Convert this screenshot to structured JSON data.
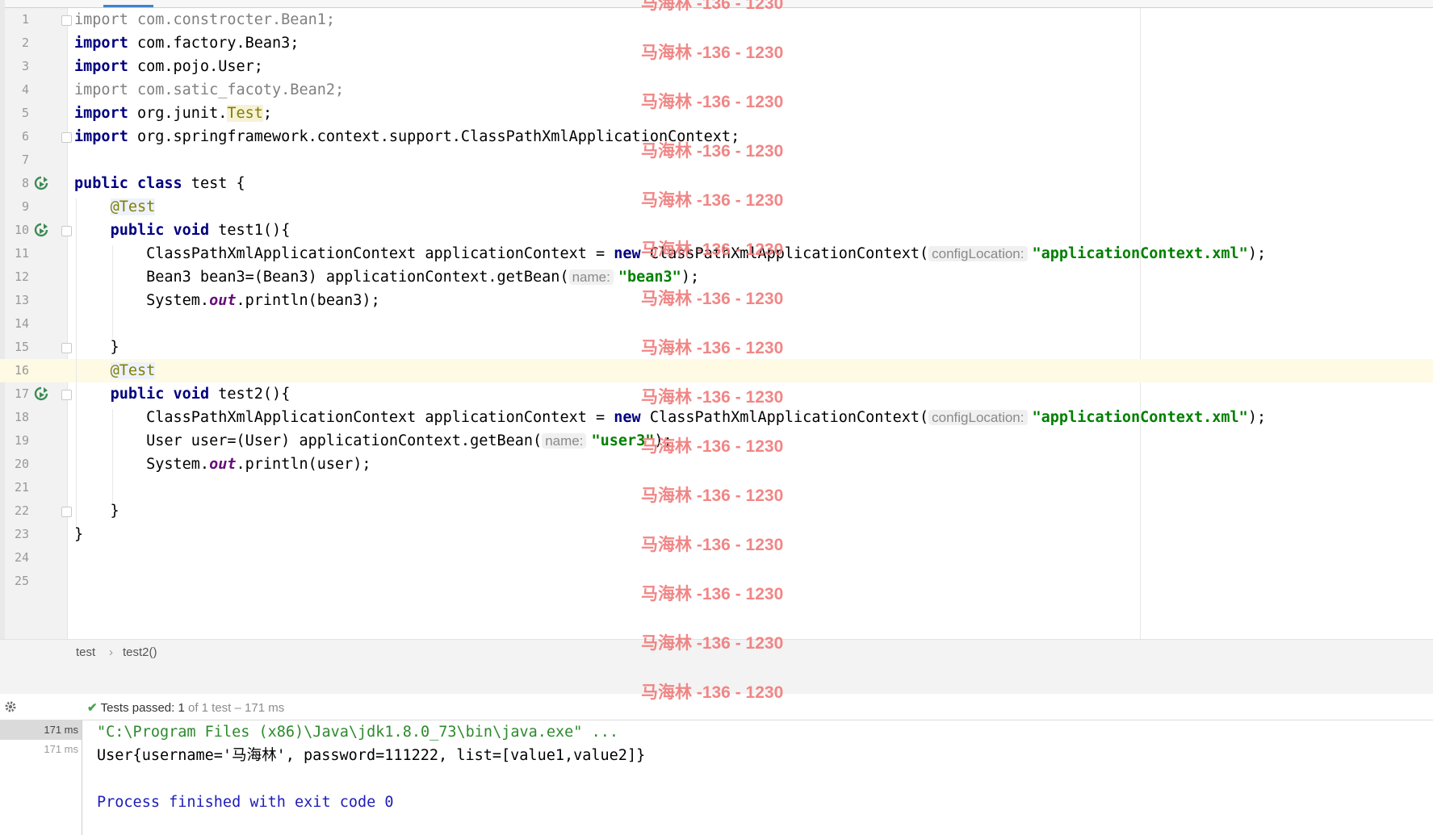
{
  "editor": {
    "lines": [
      {
        "n": "1"
      },
      {
        "n": "2"
      },
      {
        "n": "3"
      },
      {
        "n": "4"
      },
      {
        "n": "5"
      },
      {
        "n": "6"
      },
      {
        "n": "7"
      },
      {
        "n": "8"
      },
      {
        "n": "9"
      },
      {
        "n": "10"
      },
      {
        "n": "11"
      },
      {
        "n": "12"
      },
      {
        "n": "13"
      },
      {
        "n": "14"
      },
      {
        "n": "15"
      },
      {
        "n": "16"
      },
      {
        "n": "17"
      },
      {
        "n": "18"
      },
      {
        "n": "19"
      },
      {
        "n": "20"
      },
      {
        "n": "21"
      },
      {
        "n": "22"
      },
      {
        "n": "23"
      },
      {
        "n": "24"
      },
      {
        "n": "25"
      }
    ],
    "code": {
      "import_kw": "import",
      "l1_rest": " com.constrocter.Bean1;",
      "l2_rest": " com.factory.Bean3;",
      "l3_rest": " com.pojo.User;",
      "l4_rest": " com.satic_facoty.Bean2;",
      "l5_rest": " org.junit.",
      "l5_test": "Test",
      "l5_semi": ";",
      "l6_rest": " org.springframework.context.support.ClassPathXmlApplicationContext;",
      "l8_public": "public",
      "l8_class": "class",
      "l8_rest": " test {",
      "ann_test": "@Test",
      "l10_public": "public",
      "l10_void": "void",
      "l10_rest": " test1(){",
      "l11_pre": "        ClassPathXmlApplicationContext applicationContext = ",
      "new_kw": "new",
      "l11_mid": " ClassPathXmlApplicationContext(",
      "hint_config": "configLocation:",
      "str_appctx": "\"applicationContext.xml\"",
      "l11_end": ");",
      "l12_pre": "        Bean3 bean3=(Bean3) applicationContext.getBean(",
      "hint_name": "name:",
      "str_bean3": "\"bean3\"",
      "l12_end": ");",
      "l13_pre": "        System.",
      "out_field": "out",
      "l13_end": ".println(bean3);",
      "l15": "    }",
      "l17_public": "public",
      "l17_void": "void",
      "l17_rest": " test2(){",
      "l19_pre": "        User user=(User) applicationContext.getBean(",
      "str_user3": "\"user3\"",
      "l19_end": ");",
      "l20_end": ".println(user);",
      "l22": "    }",
      "l23": "}"
    }
  },
  "breadcrumb": {
    "item1": "test",
    "sep": "›",
    "item2": "test2()"
  },
  "run": {
    "status_prefix": "Tests passed:",
    "status_count": "1",
    "status_rest": "of 1 test – 171 ms",
    "times": [
      "171 ms",
      "171 ms"
    ],
    "console": [
      "\"C:\\Program Files (x86)\\Java\\jdk1.8.0_73\\bin\\java.exe\" ...",
      "User{username='马海林', password=111222, list=[value1,value2]}",
      "",
      "Process finished with exit code 0"
    ]
  },
  "watermark": {
    "text": "马海林 -136 - 1230"
  },
  "colors": {
    "keyword": "#000080",
    "string": "#008000",
    "annotation": "#808000",
    "current_line": "#fefae3",
    "watermark": "#f07a7a",
    "pass_check": "#4aa150"
  }
}
